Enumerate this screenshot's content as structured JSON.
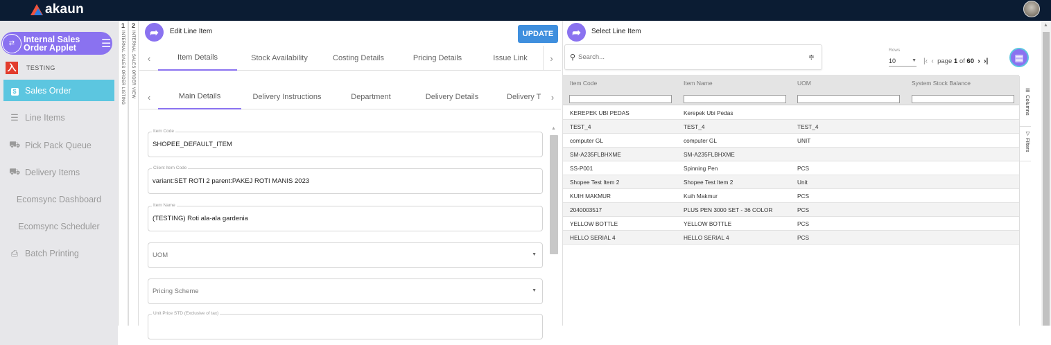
{
  "app": {
    "logo_text": "akaun",
    "header_color": "#0b1c33",
    "accent": "#8a72f0",
    "active_nav": "#5cc6e0",
    "primary_button": "#3f8fde"
  },
  "sidebar": {
    "applet_name": "Internal Sales Order Applet",
    "applet_icon": "applet-icon",
    "menu_icon": "menu-collapse-icon",
    "org_label": "TESTING",
    "items": [
      {
        "label": "Sales Order",
        "icon": "dollar-icon",
        "active": true
      },
      {
        "label": "Line Items",
        "icon": "list-icon",
        "active": false
      },
      {
        "label": "Pick Pack Queue",
        "icon": "truck-icon",
        "active": false
      },
      {
        "label": "Delivery Items",
        "icon": "truck-icon",
        "active": false
      },
      {
        "label": "Ecomsync Dashboard",
        "icon": "",
        "active": false
      },
      {
        "label": "Ecomsync Scheduler",
        "icon": "",
        "active": false
      },
      {
        "label": "Batch Printing",
        "icon": "printer-icon",
        "active": false
      }
    ]
  },
  "vertical_tabs": [
    {
      "number": "1",
      "label": "INTERNAL SALES ORDER LISTING"
    },
    {
      "number": "2",
      "label": "INTERNAL SALES ORDER VIEW"
    }
  ],
  "edit_panel": {
    "title": "Edit Line Item",
    "update_label": "UPDATE",
    "tabs": [
      "Item Details",
      "Stock Availability",
      "Costing Details",
      "Pricing Details",
      "Issue Link"
    ],
    "subtabs": [
      "Main Details",
      "Delivery Instructions",
      "Department",
      "Delivery Details",
      "Delivery T"
    ],
    "fields": [
      {
        "label": "Item Code",
        "value": "SHOPEE_DEFAULT_ITEM"
      },
      {
        "label": "Client Item Code",
        "value": "variant:SET ROTI 2 parent:PAKEJ ROTI MANIS 2023"
      },
      {
        "label": "Item Name",
        "value": "(TESTING) Roti ala-ala gardenia"
      },
      {
        "label": "",
        "placeholder": "UOM"
      },
      {
        "label": "",
        "placeholder": "Pricing Scheme"
      },
      {
        "label": "Unit Price STD (Exclusive of tax)",
        "value": ""
      }
    ]
  },
  "select_panel": {
    "title": "Select Line Item",
    "search_placeholder": "Search...",
    "rows_label": "Rows",
    "rows_value": "10",
    "page_label": "page",
    "page_current": "1",
    "page_of": "of",
    "page_total": "60",
    "columns": [
      "Item Code",
      "Item Name",
      "UOM",
      "System Stock Balance"
    ],
    "rows": [
      [
        "KEREPEK UBI PEDAS",
        "Kerepek Ubi Pedas",
        "",
        ""
      ],
      [
        "TEST_4",
        "TEST_4",
        "TEST_4",
        ""
      ],
      [
        "computer GL",
        "computer GL",
        "UNIT",
        ""
      ],
      [
        "SM-A235FLBHXME",
        "SM-A235FLBHXME",
        "",
        ""
      ],
      [
        "SS-P001",
        "Spinning Pen",
        "PCS",
        ""
      ],
      [
        "Shopee Test Item 2",
        "Shopee Test Item 2",
        "Unit",
        ""
      ],
      [
        "KUIH MAKMUR",
        "Kuih Makmur",
        "PCS",
        ""
      ],
      [
        "2040003517",
        "PLUS PEN 3000 SET - 36 COLOR",
        "PCS",
        ""
      ],
      [
        "YELLOW BOTTLE",
        "YELLOW BOTTLE",
        "PCS",
        ""
      ],
      [
        "HELLO SERIAL 4",
        "HELLO SERIAL 4",
        "PCS",
        ""
      ]
    ],
    "side_tools": [
      "Columns",
      "Filters"
    ]
  }
}
